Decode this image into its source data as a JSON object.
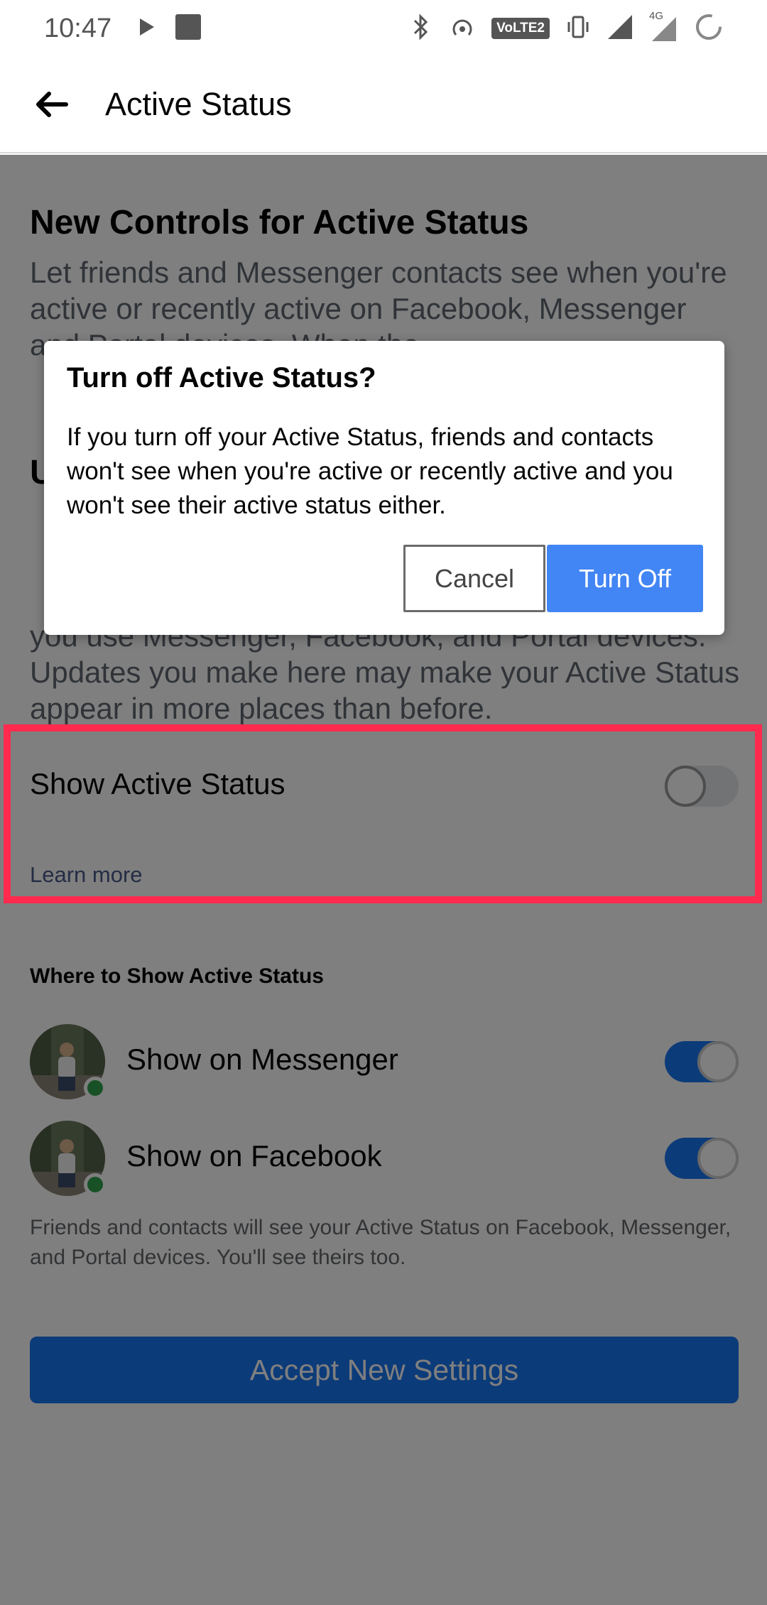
{
  "status_bar": {
    "time": "10:47",
    "volte_label": "VoLTE2",
    "network_label": "4G",
    "icons": [
      "play-icon",
      "stop-icon",
      "bluetooth-icon",
      "hotspot-icon",
      "volte-icon",
      "vibrate-icon",
      "signal-icon",
      "signal-4g-icon",
      "loading-icon"
    ]
  },
  "app_bar": {
    "title": "Active Status",
    "back_icon": "back-arrow-icon"
  },
  "content": {
    "heading": "New Controls for Active Status",
    "intro_text": "Let friends and Messenger contacts see when you're active or recently active on Facebook, Messenger and Portal devices. When the",
    "intro_text_continued": "you use Messenger, Facebook, and Portal devices. Updates you make here may make your Active Status appear in more places than before.",
    "subheading_partial": "U",
    "show_active_status": {
      "label": "Show Active Status",
      "enabled": false,
      "learn_more": "Learn more"
    },
    "where_title": "Where to Show Active Status",
    "platforms": [
      {
        "label": "Show on Messenger",
        "enabled": true,
        "online": true
      },
      {
        "label": "Show on Facebook",
        "enabled": true,
        "online": true
      }
    ],
    "footnote": "Friends and contacts will see your Active Status on Facebook, Messenger, and Portal devices. You'll see theirs too.",
    "accept_button": "Accept New Settings"
  },
  "dialog": {
    "title": "Turn off Active Status?",
    "body": "If you turn off your Active Status, friends and contacts won't see when you're active or recently active and you won't see their active status either.",
    "cancel_button": "Cancel",
    "confirm_button": "Turn Off"
  },
  "colors": {
    "accent": "#1877f2",
    "dialog_confirm": "#4285f4",
    "highlight": "#ff2a4d",
    "online": "#31a24c"
  }
}
